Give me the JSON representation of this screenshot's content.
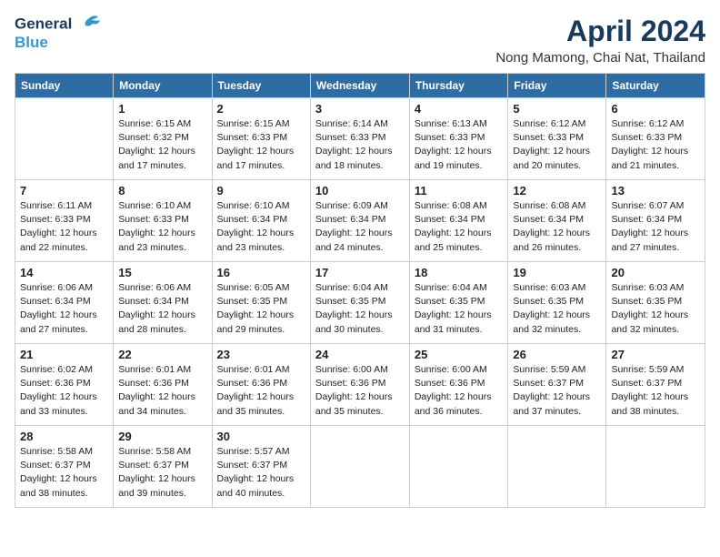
{
  "logo": {
    "line1": "General",
    "line2": "Blue"
  },
  "title": "April 2024",
  "location": "Nong Mamong, Chai Nat, Thailand",
  "headers": [
    "Sunday",
    "Monday",
    "Tuesday",
    "Wednesday",
    "Thursday",
    "Friday",
    "Saturday"
  ],
  "weeks": [
    [
      {
        "day": "",
        "info": ""
      },
      {
        "day": "1",
        "info": "Sunrise: 6:15 AM\nSunset: 6:32 PM\nDaylight: 12 hours\nand 17 minutes."
      },
      {
        "day": "2",
        "info": "Sunrise: 6:15 AM\nSunset: 6:33 PM\nDaylight: 12 hours\nand 17 minutes."
      },
      {
        "day": "3",
        "info": "Sunrise: 6:14 AM\nSunset: 6:33 PM\nDaylight: 12 hours\nand 18 minutes."
      },
      {
        "day": "4",
        "info": "Sunrise: 6:13 AM\nSunset: 6:33 PM\nDaylight: 12 hours\nand 19 minutes."
      },
      {
        "day": "5",
        "info": "Sunrise: 6:12 AM\nSunset: 6:33 PM\nDaylight: 12 hours\nand 20 minutes."
      },
      {
        "day": "6",
        "info": "Sunrise: 6:12 AM\nSunset: 6:33 PM\nDaylight: 12 hours\nand 21 minutes."
      }
    ],
    [
      {
        "day": "7",
        "info": "Sunrise: 6:11 AM\nSunset: 6:33 PM\nDaylight: 12 hours\nand 22 minutes."
      },
      {
        "day": "8",
        "info": "Sunrise: 6:10 AM\nSunset: 6:33 PM\nDaylight: 12 hours\nand 23 minutes."
      },
      {
        "day": "9",
        "info": "Sunrise: 6:10 AM\nSunset: 6:34 PM\nDaylight: 12 hours\nand 23 minutes."
      },
      {
        "day": "10",
        "info": "Sunrise: 6:09 AM\nSunset: 6:34 PM\nDaylight: 12 hours\nand 24 minutes."
      },
      {
        "day": "11",
        "info": "Sunrise: 6:08 AM\nSunset: 6:34 PM\nDaylight: 12 hours\nand 25 minutes."
      },
      {
        "day": "12",
        "info": "Sunrise: 6:08 AM\nSunset: 6:34 PM\nDaylight: 12 hours\nand 26 minutes."
      },
      {
        "day": "13",
        "info": "Sunrise: 6:07 AM\nSunset: 6:34 PM\nDaylight: 12 hours\nand 27 minutes."
      }
    ],
    [
      {
        "day": "14",
        "info": "Sunrise: 6:06 AM\nSunset: 6:34 PM\nDaylight: 12 hours\nand 27 minutes."
      },
      {
        "day": "15",
        "info": "Sunrise: 6:06 AM\nSunset: 6:34 PM\nDaylight: 12 hours\nand 28 minutes."
      },
      {
        "day": "16",
        "info": "Sunrise: 6:05 AM\nSunset: 6:35 PM\nDaylight: 12 hours\nand 29 minutes."
      },
      {
        "day": "17",
        "info": "Sunrise: 6:04 AM\nSunset: 6:35 PM\nDaylight: 12 hours\nand 30 minutes."
      },
      {
        "day": "18",
        "info": "Sunrise: 6:04 AM\nSunset: 6:35 PM\nDaylight: 12 hours\nand 31 minutes."
      },
      {
        "day": "19",
        "info": "Sunrise: 6:03 AM\nSunset: 6:35 PM\nDaylight: 12 hours\nand 32 minutes."
      },
      {
        "day": "20",
        "info": "Sunrise: 6:03 AM\nSunset: 6:35 PM\nDaylight: 12 hours\nand 32 minutes."
      }
    ],
    [
      {
        "day": "21",
        "info": "Sunrise: 6:02 AM\nSunset: 6:36 PM\nDaylight: 12 hours\nand 33 minutes."
      },
      {
        "day": "22",
        "info": "Sunrise: 6:01 AM\nSunset: 6:36 PM\nDaylight: 12 hours\nand 34 minutes."
      },
      {
        "day": "23",
        "info": "Sunrise: 6:01 AM\nSunset: 6:36 PM\nDaylight: 12 hours\nand 35 minutes."
      },
      {
        "day": "24",
        "info": "Sunrise: 6:00 AM\nSunset: 6:36 PM\nDaylight: 12 hours\nand 35 minutes."
      },
      {
        "day": "25",
        "info": "Sunrise: 6:00 AM\nSunset: 6:36 PM\nDaylight: 12 hours\nand 36 minutes."
      },
      {
        "day": "26",
        "info": "Sunrise: 5:59 AM\nSunset: 6:37 PM\nDaylight: 12 hours\nand 37 minutes."
      },
      {
        "day": "27",
        "info": "Sunrise: 5:59 AM\nSunset: 6:37 PM\nDaylight: 12 hours\nand 38 minutes."
      }
    ],
    [
      {
        "day": "28",
        "info": "Sunrise: 5:58 AM\nSunset: 6:37 PM\nDaylight: 12 hours\nand 38 minutes."
      },
      {
        "day": "29",
        "info": "Sunrise: 5:58 AM\nSunset: 6:37 PM\nDaylight: 12 hours\nand 39 minutes."
      },
      {
        "day": "30",
        "info": "Sunrise: 5:57 AM\nSunset: 6:37 PM\nDaylight: 12 hours\nand 40 minutes."
      },
      {
        "day": "",
        "info": ""
      },
      {
        "day": "",
        "info": ""
      },
      {
        "day": "",
        "info": ""
      },
      {
        "day": "",
        "info": ""
      }
    ]
  ]
}
